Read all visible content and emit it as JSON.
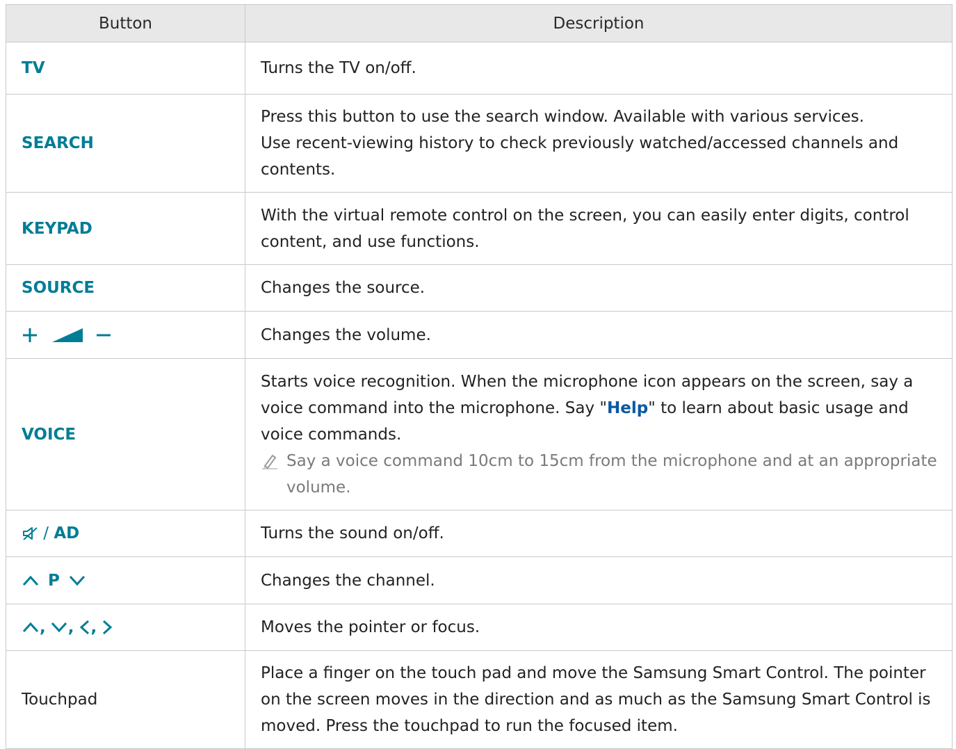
{
  "table": {
    "headers": [
      "Button",
      "Description"
    ],
    "rows": [
      {
        "button": "TV",
        "description": [
          "Turns the TV on/off."
        ]
      },
      {
        "button": "SEARCH",
        "description": [
          "Press this button to use the search window. Available with various services.",
          "Use recent-viewing history to check previously watched/accessed channels and contents."
        ]
      },
      {
        "button": "KEYPAD",
        "description": [
          "With the virtual remote control on the screen, you can easily enter digits, control content, and use functions."
        ]
      },
      {
        "button": "SOURCE",
        "description": [
          "Changes the source."
        ]
      },
      {
        "button_icons": [
          "plus-icon",
          "volume-wedge-icon",
          "minus-icon"
        ],
        "description": [
          "Changes the volume."
        ]
      },
      {
        "button": "VOICE",
        "description_parts": [
          "Starts voice recognition. When the microphone icon appears on the screen, say a voice command into the microphone. Say \"",
          "Help",
          "\" to learn about basic usage and voice commands."
        ],
        "note": "Say a voice command 10cm to 15cm from the microphone and at an appropriate volume."
      },
      {
        "button_icons": [
          "mute-icon"
        ],
        "button_separator": " / ",
        "button": "AD",
        "description": [
          "Turns the sound on/off."
        ]
      },
      {
        "button_icons": [
          "chevron-up-icon",
          "chevron-down-icon"
        ],
        "button": "P",
        "description": [
          "Changes the channel."
        ]
      },
      {
        "button_icons": [
          "chevron-up-icon",
          "chevron-down-icon",
          "chevron-left-icon",
          "chevron-right-icon"
        ],
        "button_separator": ",",
        "description": [
          "Moves the pointer or focus."
        ]
      },
      {
        "button": "Touchpad",
        "description": [
          "Place a finger on the touch pad and move the Samsung Smart Control. The pointer on the screen moves in the direction and as much as the Samsung Smart Control is moved. Press the touchpad to run the focused item."
        ]
      }
    ]
  },
  "colors": {
    "accent": "#007d96",
    "help_link": "#0a58a3",
    "header_bg": "#e8e8e8",
    "border": "#c9c9c9",
    "note_text": "#7a7a7a"
  }
}
